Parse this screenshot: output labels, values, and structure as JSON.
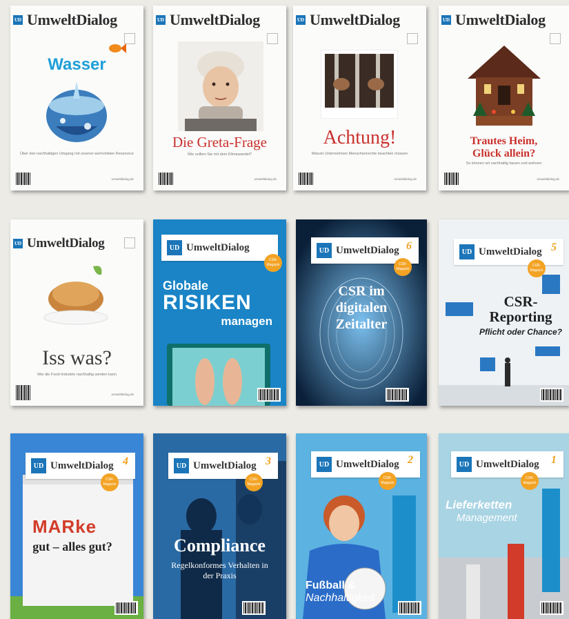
{
  "brand": "UmweltDialog",
  "ud": "UD",
  "covers": [
    {
      "headline": "Wasser"
    },
    {
      "headline": "Die Greta-Frage"
    },
    {
      "headline": "Achtung!"
    },
    {
      "headline": "Trautes Heim, Glück allein?"
    },
    {
      "headline": "Iss was?"
    },
    {
      "headline": "Globale",
      "headline2": "RISIKEN",
      "headline3": "managen"
    },
    {
      "headline": "CSR im digitalen Zeitalter",
      "issue": "6"
    },
    {
      "headline": "CSR-Reporting",
      "subhead": "Pflicht oder Chance?",
      "issue": "5"
    },
    {
      "headline": "MARke",
      "headline2": "gut – alles gut?",
      "issue": "4"
    },
    {
      "headline": "Compliance",
      "subhead": "Regelkonformes Verhalten in der Praxis",
      "issue": "3"
    },
    {
      "headline": "Fußball &",
      "headline2": "Nachhaltigkeit",
      "issue": "2"
    },
    {
      "headline": "Lieferketten",
      "headline2": "Management",
      "issue": "1"
    }
  ]
}
